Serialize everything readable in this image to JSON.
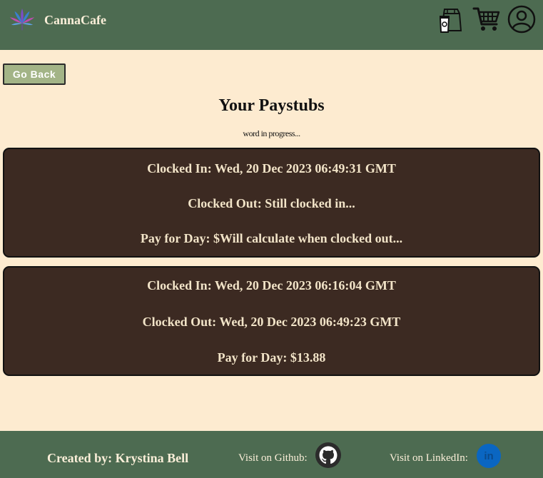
{
  "header": {
    "brand": "CannaCafe",
    "icons": [
      "cannabis-leaf-logo-icon",
      "coffee-bag-icon",
      "shopping-cart-icon",
      "user-account-icon"
    ]
  },
  "nav": {
    "back_label": "Go Back"
  },
  "main": {
    "title": "Your Paystubs",
    "subtitle": "word in progress..."
  },
  "paystubs": [
    {
      "clocked_in": "Clocked In: Wed, 20 Dec 2023 06:49:31 GMT",
      "clocked_out": "Clocked Out: Still clocked in...",
      "pay": "Pay for Day: $Will calculate when clocked out..."
    },
    {
      "clocked_in": "Clocked In: Wed, 20 Dec 2023 06:16:04 GMT",
      "clocked_out": "Clocked Out: Wed, 20 Dec 2023 06:49:23 GMT",
      "pay": "Pay for Day: $13.88"
    }
  ],
  "footer": {
    "credit": "Created by: Krystina Bell",
    "github_label": "Visit on Github:",
    "linkedin_label": "Visit on LinkedIn:",
    "linkedin_glyph": "in"
  },
  "colors": {
    "header_bg": "#4d6b51",
    "page_bg": "#fdebd0",
    "card_bg": "#3c2a22",
    "button_bg": "#a3b487"
  }
}
